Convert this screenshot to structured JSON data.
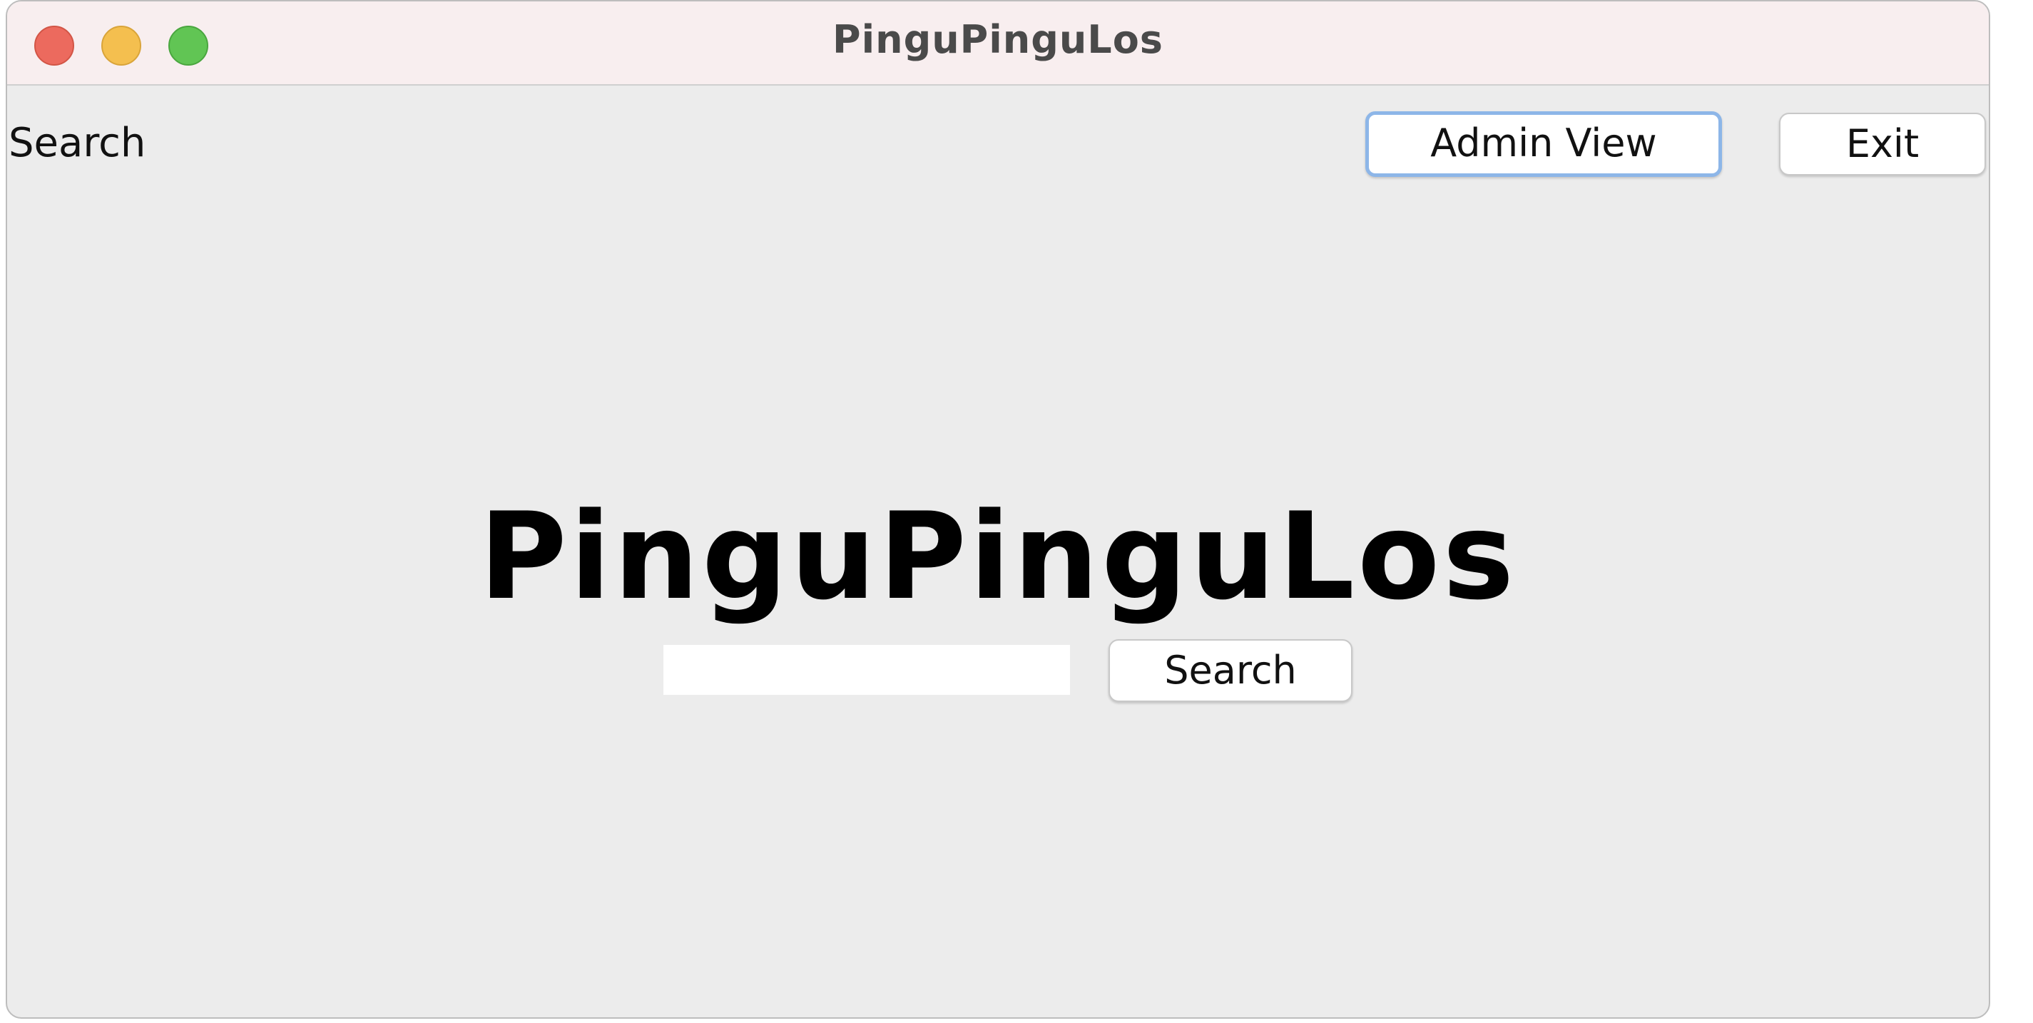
{
  "window": {
    "title": "PinguPinguLos"
  },
  "header": {
    "label": "Search",
    "admin_button": "Admin View",
    "exit_button": "Exit"
  },
  "main": {
    "title": "PinguPinguLos",
    "search_value": "",
    "search_button": "Search"
  }
}
